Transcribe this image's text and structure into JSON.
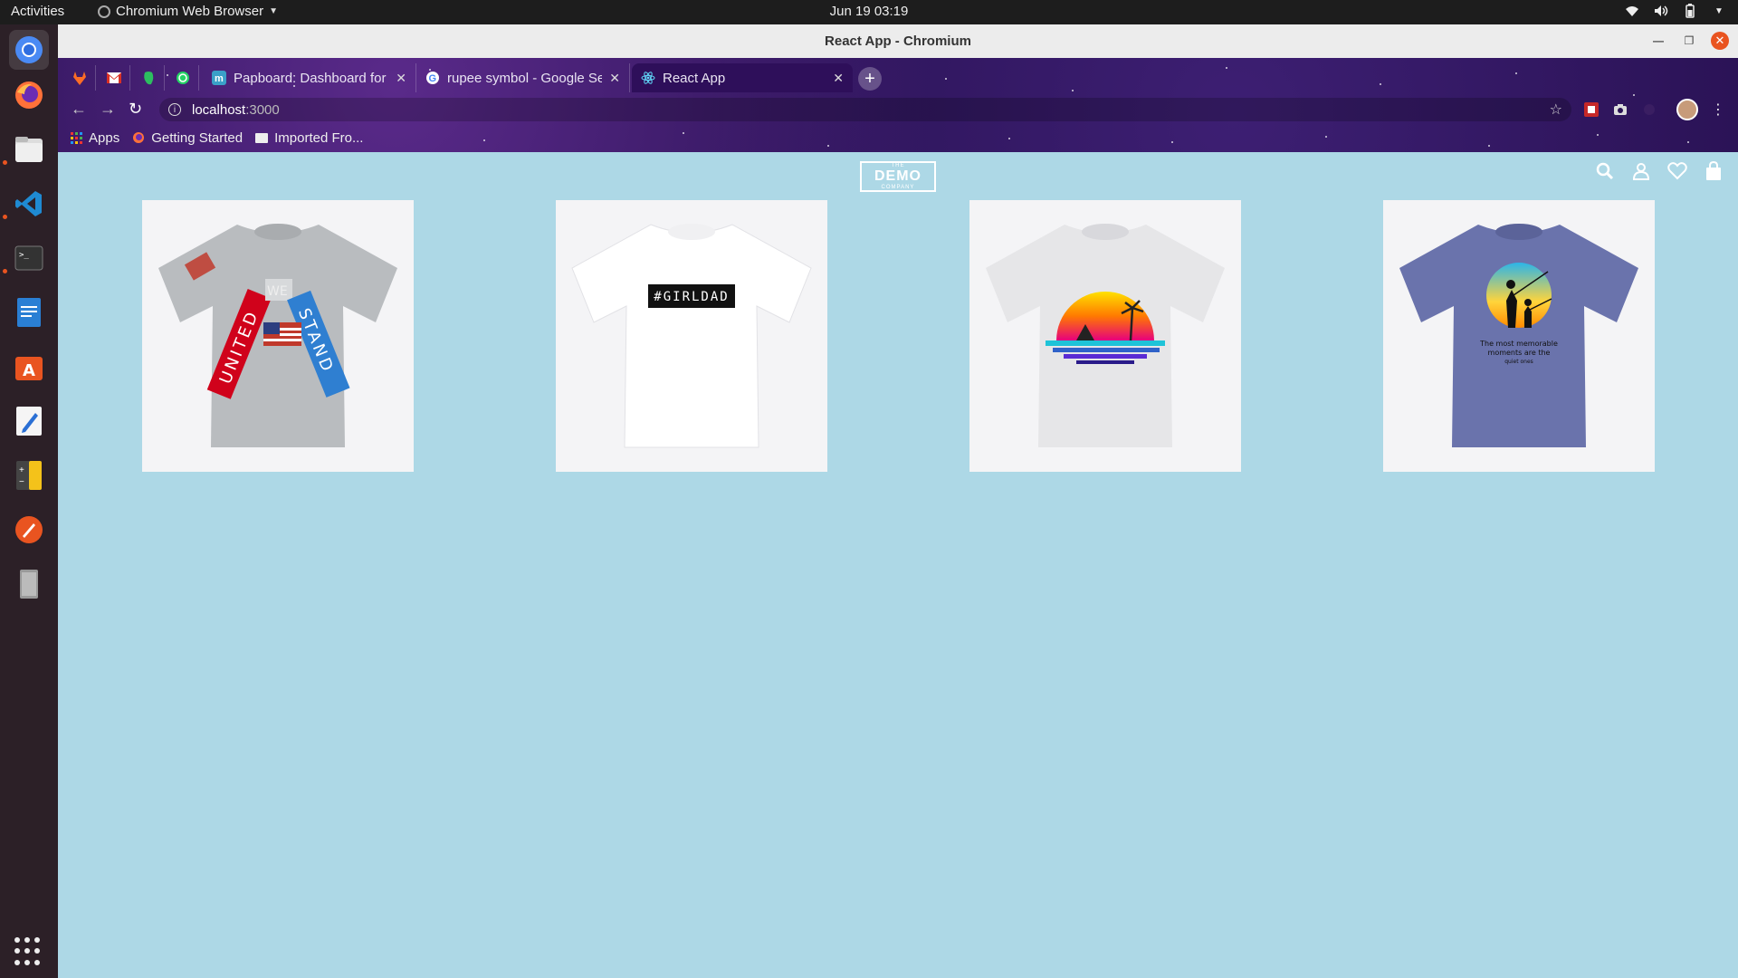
{
  "system": {
    "activities": "Activities",
    "app_name": "Chromium Web Browser",
    "clock": "Jun 19  03:19"
  },
  "window": {
    "title": "React App - Chromium"
  },
  "tabs": [
    {
      "label": "Papboard: Dashboard for",
      "icon": "m-logo-icon"
    },
    {
      "label": "rupee symbol - Google Se",
      "icon": "google-icon"
    },
    {
      "label": "React App",
      "icon": "react-icon",
      "active": true
    }
  ],
  "address": {
    "host": "localhost",
    "port": ":3000"
  },
  "bookmarks": [
    {
      "label": "Apps"
    },
    {
      "label": "Getting Started"
    },
    {
      "label": "Imported Fro..."
    }
  ],
  "page": {
    "background": "#add8e6",
    "logo": {
      "top": "THE",
      "main": "DEMO",
      "bottom": "COMPANY"
    },
    "products": [
      {
        "name": "united-we-stand-tshirt",
        "shirt_color": "#b9bcbf",
        "print": [
          "UNITED",
          "WE",
          "STAND"
        ]
      },
      {
        "name": "girldad-tshirt",
        "shirt_color": "#ffffff",
        "print": [
          "#GIRLDAD"
        ]
      },
      {
        "name": "sunset-fishing-tshirt",
        "shirt_color": "#e6e6e8",
        "print": []
      },
      {
        "name": "memorable-moments-tshirt",
        "shirt_color": "#6a73ac",
        "print": [
          "The most memorable",
          "moments are the",
          "quiet ones"
        ]
      }
    ]
  }
}
